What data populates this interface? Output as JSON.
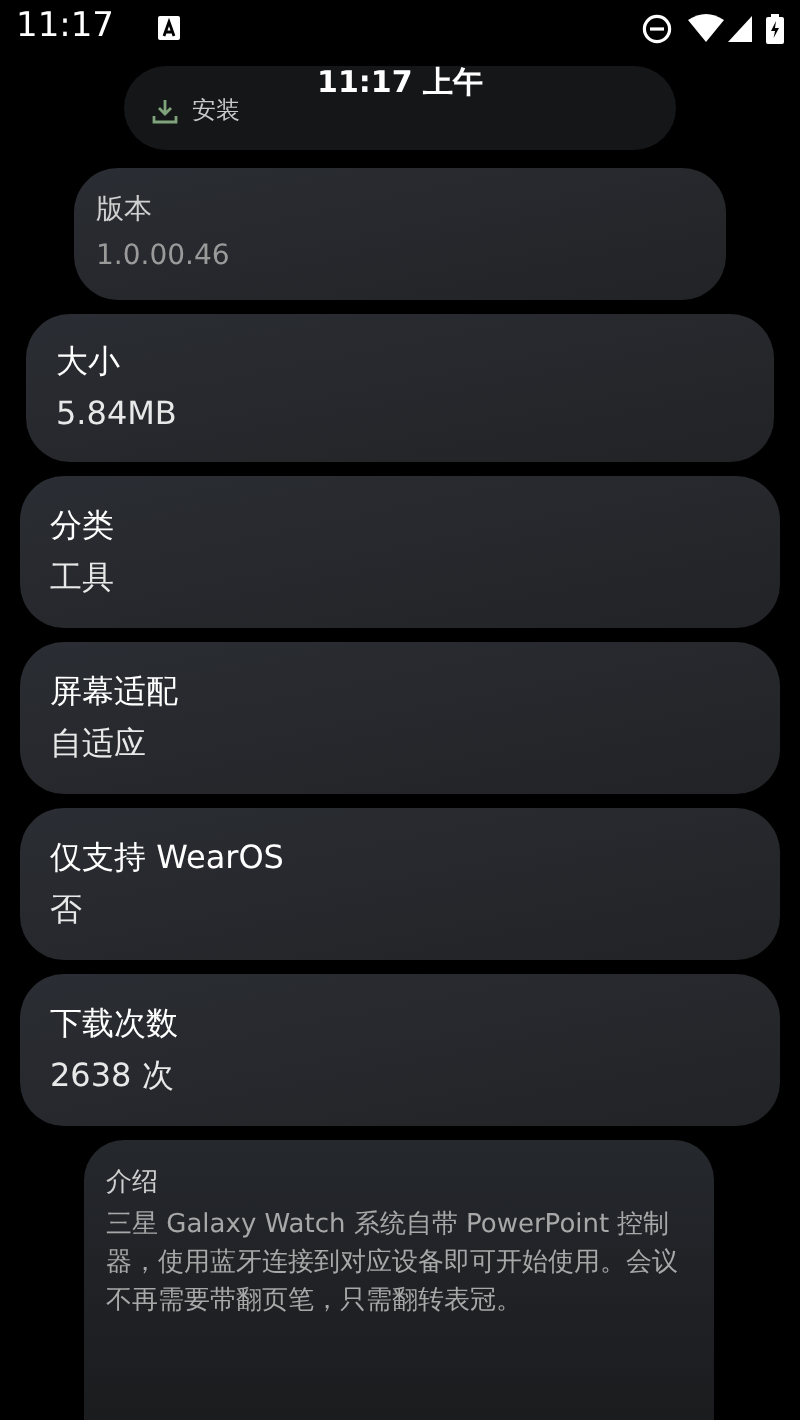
{
  "status_bar": {
    "time": "11:17"
  },
  "watch_time": "11:17 上午",
  "install_button": {
    "label": "安装"
  },
  "info_cards": [
    {
      "label": "版本",
      "value": "1.0.00.46"
    },
    {
      "label": "大小",
      "value": "5.84MB"
    },
    {
      "label": "分类",
      "value": "工具"
    },
    {
      "label": "屏幕适配",
      "value": "自适应"
    },
    {
      "label": "仅支持 WearOS",
      "value": "否"
    },
    {
      "label": "下载次数",
      "value": "2638 次"
    }
  ],
  "description": {
    "label": "介绍",
    "text": "三星 Galaxy Watch 系统自带 PowerPoint 控制器，使用蓝牙连接到对应设备即可开始使用。会议不再需要带翻页笔，只需翻转表冠。"
  }
}
